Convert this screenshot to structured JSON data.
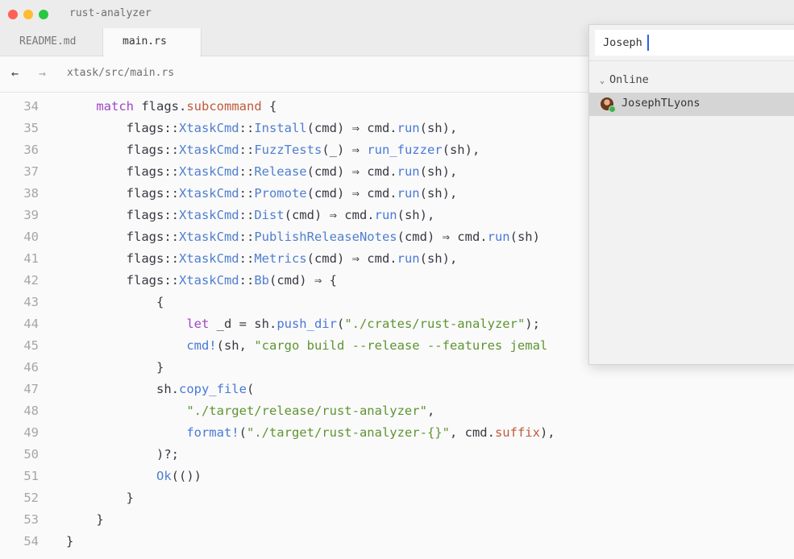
{
  "window": {
    "title": "rust-analyzer"
  },
  "tabs": [
    {
      "label": "README.md",
      "active": false
    },
    {
      "label": "main.rs",
      "active": true
    }
  ],
  "breadcrumb": {
    "back_icon": "←",
    "forward_icon": "→",
    "path": "xtask/src/main.rs"
  },
  "editor": {
    "lines": [
      {
        "n": "34",
        "t": [
          [
            "    ",
            ""
          ],
          [
            "match",
            "kw"
          ],
          [
            " flags.",
            ""
          ],
          [
            "subcommand",
            "prop"
          ],
          [
            " {",
            ""
          ]
        ]
      },
      {
        "n": "35",
        "t": [
          [
            "        flags::",
            ""
          ],
          [
            "XtaskCmd",
            "ty"
          ],
          [
            "::",
            ""
          ],
          [
            "Install",
            "ty"
          ],
          [
            "(cmd) ⇒ cmd.",
            ""
          ],
          [
            "run",
            "fn"
          ],
          [
            "(sh),",
            ""
          ]
        ]
      },
      {
        "n": "36",
        "t": [
          [
            "        flags::",
            ""
          ],
          [
            "XtaskCmd",
            "ty"
          ],
          [
            "::",
            ""
          ],
          [
            "FuzzTests",
            "ty"
          ],
          [
            "(_) ⇒ ",
            ""
          ],
          [
            "run_fuzzer",
            "fn"
          ],
          [
            "(sh),",
            ""
          ]
        ]
      },
      {
        "n": "37",
        "t": [
          [
            "        flags::",
            ""
          ],
          [
            "XtaskCmd",
            "ty"
          ],
          [
            "::",
            ""
          ],
          [
            "Release",
            "ty"
          ],
          [
            "(cmd) ⇒ cmd.",
            ""
          ],
          [
            "run",
            "fn"
          ],
          [
            "(sh),",
            ""
          ]
        ]
      },
      {
        "n": "38",
        "t": [
          [
            "        flags::",
            ""
          ],
          [
            "XtaskCmd",
            "ty"
          ],
          [
            "::",
            ""
          ],
          [
            "Promote",
            "ty"
          ],
          [
            "(cmd) ⇒ cmd.",
            ""
          ],
          [
            "run",
            "fn"
          ],
          [
            "(sh),",
            ""
          ]
        ]
      },
      {
        "n": "39",
        "t": [
          [
            "        flags::",
            ""
          ],
          [
            "XtaskCmd",
            "ty"
          ],
          [
            "::",
            ""
          ],
          [
            "Dist",
            "ty"
          ],
          [
            "(cmd) ⇒ cmd.",
            ""
          ],
          [
            "run",
            "fn"
          ],
          [
            "(sh),",
            ""
          ]
        ]
      },
      {
        "n": "40",
        "t": [
          [
            "        flags::",
            ""
          ],
          [
            "XtaskCmd",
            "ty"
          ],
          [
            "::",
            ""
          ],
          [
            "PublishReleaseNotes",
            "ty"
          ],
          [
            "(cmd) ⇒ cmd.",
            ""
          ],
          [
            "run",
            "fn"
          ],
          [
            "(sh)",
            ""
          ]
        ]
      },
      {
        "n": "41",
        "t": [
          [
            "        flags::",
            ""
          ],
          [
            "XtaskCmd",
            "ty"
          ],
          [
            "::",
            ""
          ],
          [
            "Metrics",
            "ty"
          ],
          [
            "(cmd) ⇒ cmd.",
            ""
          ],
          [
            "run",
            "fn"
          ],
          [
            "(sh),",
            ""
          ]
        ]
      },
      {
        "n": "42",
        "t": [
          [
            "        flags::",
            ""
          ],
          [
            "XtaskCmd",
            "ty"
          ],
          [
            "::",
            ""
          ],
          [
            "Bb",
            "ty"
          ],
          [
            "(cmd) ⇒ {",
            ""
          ]
        ]
      },
      {
        "n": "43",
        "t": [
          [
            "            {",
            ""
          ]
        ]
      },
      {
        "n": "44",
        "t": [
          [
            "                ",
            ""
          ],
          [
            "let",
            "kw"
          ],
          [
            " _d = sh.",
            ""
          ],
          [
            "push_dir",
            "fn"
          ],
          [
            "(",
            ""
          ],
          [
            "\"./crates/rust-analyzer\"",
            "str"
          ],
          [
            ");",
            ""
          ]
        ]
      },
      {
        "n": "45",
        "t": [
          [
            "                ",
            ""
          ],
          [
            "cmd!",
            "mac"
          ],
          [
            "(sh, ",
            ""
          ],
          [
            "\"cargo build --release --features jemal",
            "str"
          ]
        ]
      },
      {
        "n": "46",
        "t": [
          [
            "            }",
            ""
          ]
        ]
      },
      {
        "n": "47",
        "t": [
          [
            "            sh.",
            ""
          ],
          [
            "copy_file",
            "fn"
          ],
          [
            "(",
            ""
          ]
        ]
      },
      {
        "n": "48",
        "t": [
          [
            "                ",
            ""
          ],
          [
            "\"./target/release/rust-analyzer\"",
            "str"
          ],
          [
            ",",
            ""
          ]
        ]
      },
      {
        "n": "49",
        "t": [
          [
            "                ",
            ""
          ],
          [
            "format!",
            "mac"
          ],
          [
            "(",
            ""
          ],
          [
            "\"./target/rust-analyzer-{}\"",
            "str"
          ],
          [
            ", cmd.",
            ""
          ],
          [
            "suffix",
            "prop"
          ],
          [
            "),",
            ""
          ]
        ]
      },
      {
        "n": "50",
        "t": [
          [
            "            )?;",
            ""
          ]
        ]
      },
      {
        "n": "51",
        "t": [
          [
            "            ",
            ""
          ],
          [
            "Ok",
            "ty"
          ],
          [
            "(())",
            ""
          ]
        ]
      },
      {
        "n": "52",
        "t": [
          [
            "        }",
            ""
          ]
        ]
      },
      {
        "n": "53",
        "t": [
          [
            "    }",
            ""
          ]
        ]
      },
      {
        "n": "54",
        "t": [
          [
            "}",
            ""
          ]
        ]
      }
    ]
  },
  "popup": {
    "search_value": "Joseph",
    "section_label": "Online",
    "section_chevron": "⌄",
    "users": [
      {
        "name": "JosephTLyons",
        "status": "online"
      }
    ]
  }
}
